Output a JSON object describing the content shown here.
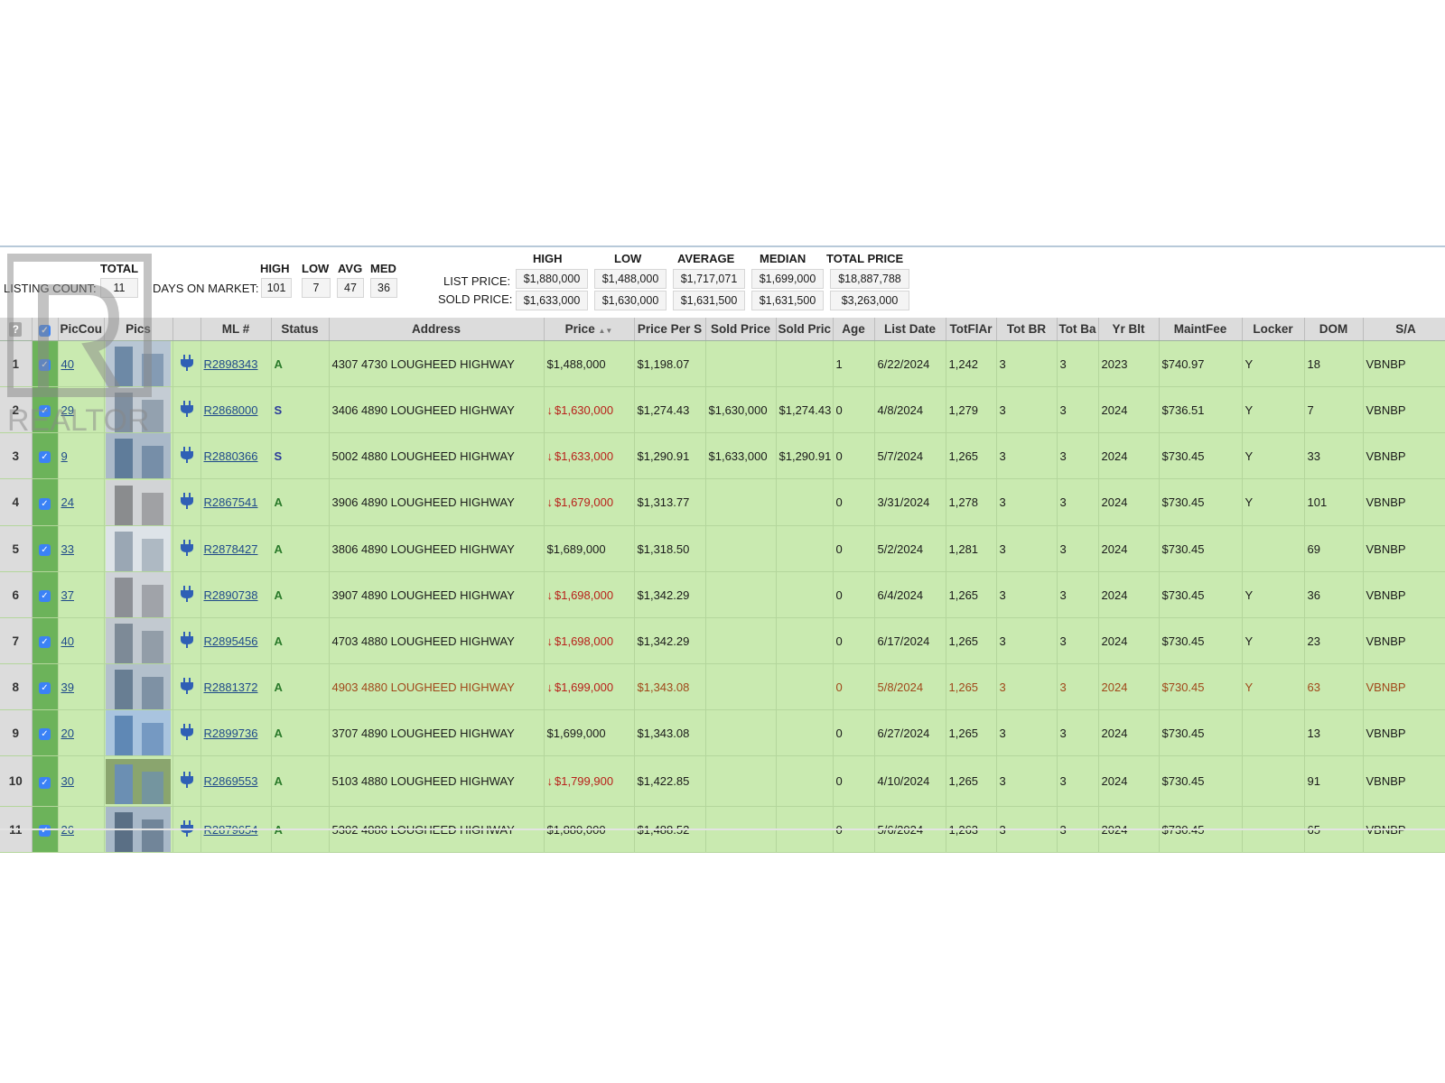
{
  "summary": {
    "total_header": "TOTAL",
    "listing_count_label": "LISTING COUNT:",
    "listing_count": "11",
    "dom_label": "DAYS ON MARKET:",
    "dom_headers": [
      "HIGH",
      "LOW",
      "AVG",
      "MED"
    ],
    "dom_values": [
      "101",
      "7",
      "47",
      "36"
    ],
    "price_headers": [
      "HIGH",
      "LOW",
      "AVERAGE",
      "MEDIAN",
      "TOTAL PRICE"
    ],
    "list_price_label": "LIST PRICE:",
    "list_price_values": [
      "$1,880,000",
      "$1,488,000",
      "$1,717,071",
      "$1,699,000",
      "$18,887,788"
    ],
    "sold_price_label": "SOLD PRICE:",
    "sold_price_values": [
      "$1,633,000",
      "$1,630,000",
      "$1,631,500",
      "$1,631,500",
      "$3,263,000"
    ]
  },
  "watermark": "REALTOR",
  "table": {
    "help_label": "?",
    "columns": [
      "PicCou",
      "Pics",
      "",
      "ML #",
      "Status",
      "Address",
      "Price",
      "Price Per S",
      "Sold Price",
      "Sold Pric",
      "Age",
      "List Date",
      "TotFlAr",
      "Tot BR",
      "Tot Ba",
      "Yr Blt",
      "MaintFee",
      "Locker",
      "DOM",
      "S/A"
    ],
    "sort_indicator": "▲▼",
    "price_drop_icon": "↓",
    "rows": [
      {
        "n": "1",
        "pic": "40",
        "ml": "R2898343",
        "status": "A",
        "address": "4307 4730 LOUGHEED HIGHWAY",
        "drop": false,
        "price": "$1,488,000",
        "pps": "$1,198.07",
        "sold": "",
        "soldpps": "",
        "age": "1",
        "date": "6/22/2024",
        "area": "1,242",
        "br": "3",
        "ba": "3",
        "yr": "2023",
        "fee": "$740.97",
        "locker": "Y",
        "dom": "18",
        "sa": "VBNBP"
      },
      {
        "n": "2",
        "pic": "29",
        "ml": "R2868000",
        "status": "S",
        "address": "3406 4890 LOUGHEED HIGHWAY",
        "drop": true,
        "price": "$1,630,000",
        "pps": "$1,274.43",
        "sold": "$1,630,000",
        "soldpps": "$1,274.43",
        "age": "0",
        "date": "4/8/2024",
        "area": "1,279",
        "br": "3",
        "ba": "3",
        "yr": "2024",
        "fee": "$736.51",
        "locker": "Y",
        "dom": "7",
        "sa": "VBNBP"
      },
      {
        "n": "3",
        "pic": "9",
        "ml": "R2880366",
        "status": "S",
        "address": "5002 4880 LOUGHEED HIGHWAY",
        "drop": true,
        "price": "$1,633,000",
        "pps": "$1,290.91",
        "sold": "$1,633,000",
        "soldpps": "$1,290.91",
        "age": "0",
        "date": "5/7/2024",
        "area": "1,265",
        "br": "3",
        "ba": "3",
        "yr": "2024",
        "fee": "$730.45",
        "locker": "Y",
        "dom": "33",
        "sa": "VBNBP"
      },
      {
        "n": "4",
        "pic": "24",
        "ml": "R2867541",
        "status": "A",
        "address": "3906 4890 LOUGHEED HIGHWAY",
        "drop": true,
        "price": "$1,679,000",
        "pps": "$1,313.77",
        "sold": "",
        "soldpps": "",
        "age": "0",
        "date": "3/31/2024",
        "area": "1,278",
        "br": "3",
        "ba": "3",
        "yr": "2024",
        "fee": "$730.45",
        "locker": "Y",
        "dom": "101",
        "sa": "VBNBP"
      },
      {
        "n": "5",
        "pic": "33",
        "ml": "R2878427",
        "status": "A",
        "address": "3806 4890 LOUGHEED HIGHWAY",
        "drop": false,
        "price": "$1,689,000",
        "pps": "$1,318.50",
        "sold": "",
        "soldpps": "",
        "age": "0",
        "date": "5/2/2024",
        "area": "1,281",
        "br": "3",
        "ba": "3",
        "yr": "2024",
        "fee": "$730.45",
        "locker": "",
        "dom": "69",
        "sa": "VBNBP"
      },
      {
        "n": "6",
        "pic": "37",
        "ml": "R2890738",
        "status": "A",
        "address": "3907 4890 LOUGHEED HIGHWAY",
        "drop": true,
        "price": "$1,698,000",
        "pps": "$1,342.29",
        "sold": "",
        "soldpps": "",
        "age": "0",
        "date": "6/4/2024",
        "area": "1,265",
        "br": "3",
        "ba": "3",
        "yr": "2024",
        "fee": "$730.45",
        "locker": "Y",
        "dom": "36",
        "sa": "VBNBP"
      },
      {
        "n": "7",
        "pic": "40",
        "ml": "R2895456",
        "status": "A",
        "address": "4703 4880 LOUGHEED HIGHWAY",
        "drop": true,
        "price": "$1,698,000",
        "pps": "$1,342.29",
        "sold": "",
        "soldpps": "",
        "age": "0",
        "date": "6/17/2024",
        "area": "1,265",
        "br": "3",
        "ba": "3",
        "yr": "2024",
        "fee": "$730.45",
        "locker": "Y",
        "dom": "23",
        "sa": "VBNBP"
      },
      {
        "n": "8",
        "pic": "39",
        "ml": "R2881372",
        "status": "A",
        "address": "4903 4880 LOUGHEED HIGHWAY",
        "drop": true,
        "price": "$1,699,000",
        "pps": "$1,343.08",
        "sold": "",
        "soldpps": "",
        "age": "0",
        "date": "5/8/2024",
        "area": "1,265",
        "br": "3",
        "ba": "3",
        "yr": "2024",
        "fee": "$730.45",
        "locker": "Y",
        "dom": "63",
        "sa": "VBNBP",
        "highlight": true
      },
      {
        "n": "9",
        "pic": "20",
        "ml": "R2899736",
        "status": "A",
        "address": "3707 4890 LOUGHEED HIGHWAY",
        "drop": false,
        "price": "$1,699,000",
        "pps": "$1,343.08",
        "sold": "",
        "soldpps": "",
        "age": "0",
        "date": "6/27/2024",
        "area": "1,265",
        "br": "3",
        "ba": "3",
        "yr": "2024",
        "fee": "$730.45",
        "locker": "",
        "dom": "13",
        "sa": "VBNBP"
      },
      {
        "n": "10",
        "pic": "30",
        "ml": "R2869553",
        "status": "A",
        "address": "5103 4880 LOUGHEED HIGHWAY",
        "drop": true,
        "price": "$1,799,900",
        "pps": "$1,422.85",
        "sold": "",
        "soldpps": "",
        "age": "0",
        "date": "4/10/2024",
        "area": "1,265",
        "br": "3",
        "ba": "3",
        "yr": "2024",
        "fee": "$730.45",
        "locker": "",
        "dom": "91",
        "sa": "VBNBP"
      },
      {
        "n": "11",
        "pic": "26",
        "ml": "R2879654",
        "status": "A",
        "address": "5302 4880 LOUGHEED HIGHWAY",
        "drop": false,
        "price": "$1,880,000",
        "pps": "$1,488.52",
        "sold": "",
        "soldpps": "",
        "age": "0",
        "date": "5/6/2024",
        "area": "1,263",
        "br": "3",
        "ba": "3",
        "yr": "2024",
        "fee": "$730.45",
        "locker": "",
        "dom": "65",
        "sa": "VBNBP"
      }
    ]
  }
}
